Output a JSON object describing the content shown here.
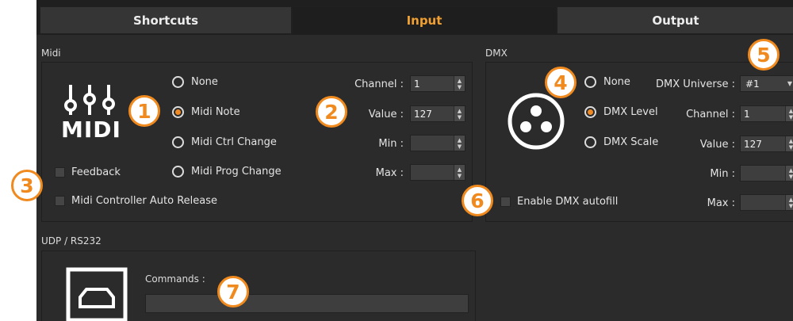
{
  "tabs": [
    {
      "label": "Shortcuts",
      "active": false
    },
    {
      "label": "Input",
      "active": true
    },
    {
      "label": "Output",
      "active": false
    }
  ],
  "accent_color": "#f08a24",
  "midi": {
    "section_label": "Midi",
    "logo_text": "MIDI",
    "mode_options": [
      "None",
      "Midi Note",
      "Midi Ctrl Change",
      "Midi Prog Change"
    ],
    "selected_mode": "Midi Note",
    "feedback_label": "Feedback",
    "auto_release_label": "Midi Controller Auto Release",
    "channel_label": "Channel :",
    "channel_value": "1",
    "value_label": "Value :",
    "value_value": "127",
    "min_label": "Min :",
    "min_value": "",
    "max_label": "Max :",
    "max_value": ""
  },
  "dmx": {
    "section_label": "DMX",
    "mode_options": [
      "None",
      "DMX Level",
      "DMX Scale"
    ],
    "selected_mode": "DMX Level",
    "universe_label": "DMX Universe :",
    "universe_value": "#1",
    "channel_label": "Channel :",
    "channel_value": "1",
    "value_label": "Value :",
    "value_value": "127",
    "min_label": "Min :",
    "min_value": "",
    "max_label": "Max :",
    "max_value": "",
    "autofill_label": "Enable DMX autofill"
  },
  "udp": {
    "section_label": "UDP / RS232",
    "commands_label": "Commands :",
    "commands_value": ""
  },
  "callouts": [
    "1",
    "2",
    "3",
    "4",
    "5",
    "6",
    "7"
  ]
}
